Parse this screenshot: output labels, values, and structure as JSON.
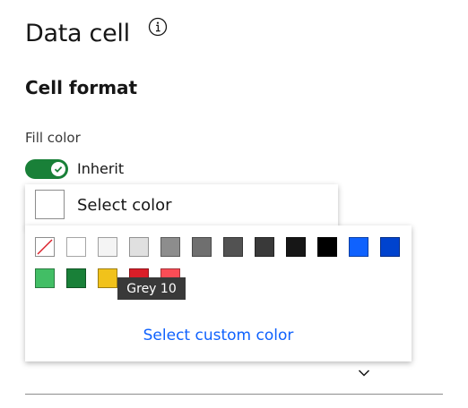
{
  "header": {
    "title": "Data cell"
  },
  "section": {
    "title": "Cell format"
  },
  "fill": {
    "label": "Fill color",
    "inherit_label": "Inherit",
    "inherit_on": true,
    "select_label": "Select color"
  },
  "palette": {
    "custom_link": "Select custom color",
    "tooltip": "Grey 10",
    "swatches": [
      {
        "name": "no-color",
        "color": "none"
      },
      {
        "name": "white",
        "color": "#ffffff"
      },
      {
        "name": "grey-10",
        "color": "#f4f4f4"
      },
      {
        "name": "grey-20",
        "color": "#e0e0e0"
      },
      {
        "name": "grey-40",
        "color": "#8d8d8d"
      },
      {
        "name": "grey-60",
        "color": "#6f6f6f"
      },
      {
        "name": "grey-70",
        "color": "#525252"
      },
      {
        "name": "grey-80",
        "color": "#393939"
      },
      {
        "name": "grey-90",
        "color": "#161616"
      },
      {
        "name": "black",
        "color": "#000000"
      },
      {
        "name": "blue-60",
        "color": "#0f62fe"
      },
      {
        "name": "blue-70",
        "color": "#0043ce"
      },
      {
        "name": "green-40",
        "color": "#42be65"
      },
      {
        "name": "green-60",
        "color": "#198038"
      },
      {
        "name": "yellow-30",
        "color": "#f1c21b"
      },
      {
        "name": "red-60",
        "color": "#da1e28"
      },
      {
        "name": "red-50",
        "color": "#fa4d56"
      }
    ]
  },
  "colors": {
    "accent": "#0f62fe",
    "toggle_on": "#198038",
    "tooltip_bg": "#393939"
  }
}
